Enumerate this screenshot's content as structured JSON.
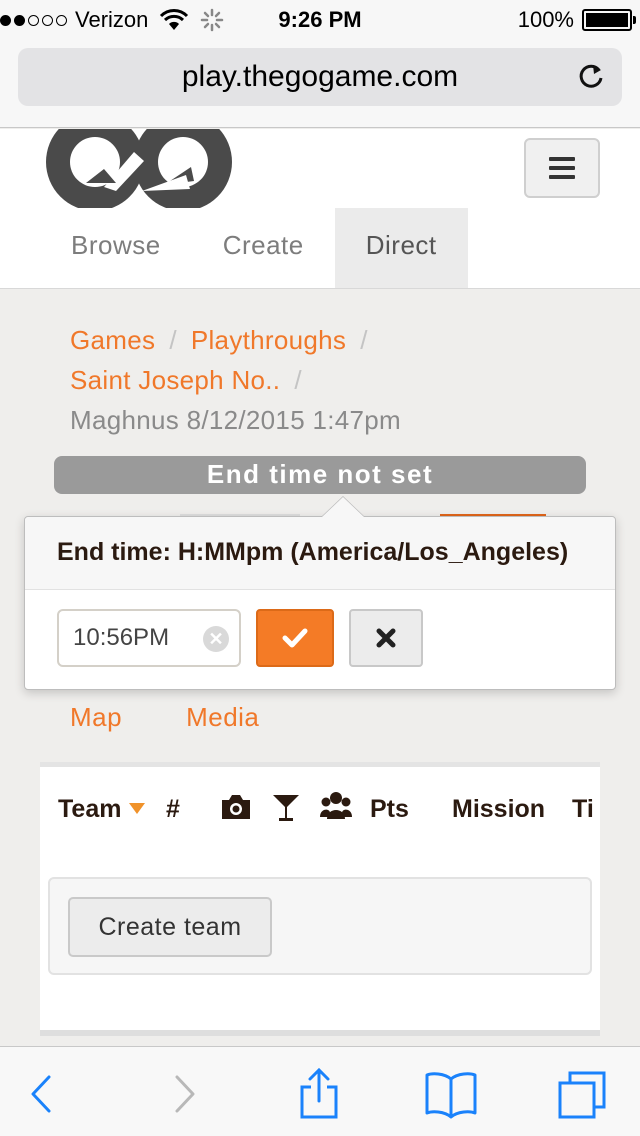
{
  "status_bar": {
    "carrier": "Verizon",
    "signal_bars": 2,
    "time": "9:26 PM",
    "battery": "100%",
    "battery_level": 1.0
  },
  "browser": {
    "url": "play.thegogame.com"
  },
  "header": {
    "logo_name": "go-game-logo",
    "nav": [
      {
        "label": "Browse",
        "active": false
      },
      {
        "label": "Create",
        "active": false
      },
      {
        "label": "Direct",
        "active": true
      }
    ]
  },
  "breadcrumb": {
    "items": [
      "Games",
      "Playthroughs",
      "Saint Joseph No.."
    ],
    "current": "Maghnus 8/12/2015 1:47pm"
  },
  "end_time_bar": "End time not set",
  "popover": {
    "title": "End time: H:MMpm (America/Los_Angeles)",
    "input_value": "10:56PM",
    "clear_icon": "clear-icon",
    "confirm_icon": "check-icon",
    "cancel_icon": "close-icon"
  },
  "subtabs": [
    "Map",
    "Media"
  ],
  "table": {
    "headers": [
      "Team",
      "#",
      "camera-icon",
      "cocktail-icon",
      "users-icon",
      "Pts",
      "Mission",
      "Ti"
    ],
    "team_header": "Team",
    "num_header": "#",
    "pts_header": "Pts",
    "mission_header": "Mission",
    "time_header_truncated": "Ti"
  },
  "create_team_label": "Create team",
  "colors": {
    "accent": "#f47b26",
    "link": "#f0782a",
    "end_bar": "#9a9a9a",
    "ios_blue": "#1a82fb"
  }
}
